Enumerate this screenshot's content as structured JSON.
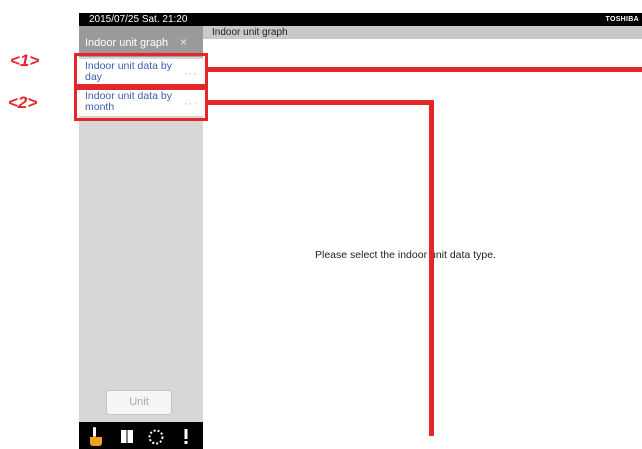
{
  "callouts": {
    "one": "<1>",
    "two": "<2>"
  },
  "status_bar": {
    "datetime": "2015/07/25 Sat. 21:20",
    "brand": "TOSHIBA"
  },
  "sidebar": {
    "title": "Indoor unit graph",
    "close_symbol": "×",
    "items": [
      {
        "label": "Indoor unit data by day",
        "more": "···"
      },
      {
        "label": "Indoor unit data by month",
        "more": "···"
      }
    ],
    "unit_button": "Unit"
  },
  "nav": {
    "icons": [
      "hand-pointer-icon",
      "book-icon",
      "dotted-circle-icon",
      "exclamation-icon"
    ]
  },
  "content": {
    "header": "Indoor unit graph",
    "placeholder": "Please select the indoor unit data type."
  },
  "colors": {
    "callout": "#e3262a",
    "link": "#3b5fb0",
    "accent_hand": "#f0a020"
  }
}
